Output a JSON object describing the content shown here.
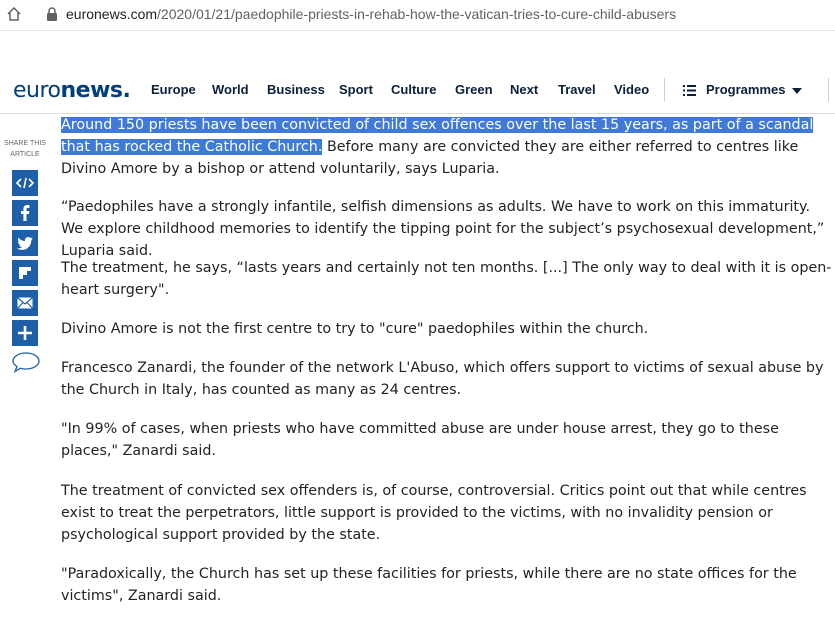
{
  "browser": {
    "url_domain": "euronews.com",
    "url_path": "/2020/01/21/paedophile-priests-in-rehab-how-the-vatican-tries-to-cure-child-abusers"
  },
  "nav": {
    "logo_part1": "euro",
    "logo_part2": "news.",
    "items": [
      "Europe",
      "World",
      "Business",
      "Sport",
      "Culture",
      "Green",
      "Next",
      "Travel",
      "Video"
    ],
    "programmes_label": "Programmes"
  },
  "share": {
    "label_line1": "SHARE THIS",
    "label_line2": "ARTICLE",
    "buttons": [
      "embed-icon",
      "facebook-icon",
      "twitter-icon",
      "flipboard-icon",
      "email-icon",
      "more-icon",
      "comment-icon"
    ],
    "accent_color": "#1f5fa8"
  },
  "article": {
    "p1_highlight": "Around 150 priests have been convicted of child sex offences over the last 15 years, as part of a scandal that has rocked the Catholic Church.",
    "p1_rest": " Before many are convicted they are either referred to centres like Divino Amore by a bishop or attend voluntarily, says Luparia.",
    "p2": "“Paedophiles have a strongly infantile, selfish dimensions as adults. We have to work on this immaturity. We explore childhood memories to identify the tipping point for the subject’s psychosexual development,” Luparia said.",
    "p3": "The treatment, he says, “lasts years and certainly not ten months. [...] The only way to deal with it is open-heart surgery\".",
    "p4": "Divino Amore is not the first centre to try to \"cure\" paedophiles within the church.",
    "p5": "Francesco Zanardi, the founder of the network L'Abuso, which offers support to victims of sexual abuse by the Church in Italy, has counted as many as 24 centres.",
    "p6": "\"In 99% of cases, when priests who have committed abuse are under house arrest, they go to these places,\" Zanardi said.",
    "p7": "The treatment of convicted sex offenders is, of course, controversial. Critics point out that while centres exist to treat the perpetrators, little support is provided to the victims, with no invalidity pension or psychological support provided by the state.",
    "p8": "\"Paradoxically, the Church has set up these facilities for priests, while there are no state offices for the victims\", Zanardi said."
  }
}
